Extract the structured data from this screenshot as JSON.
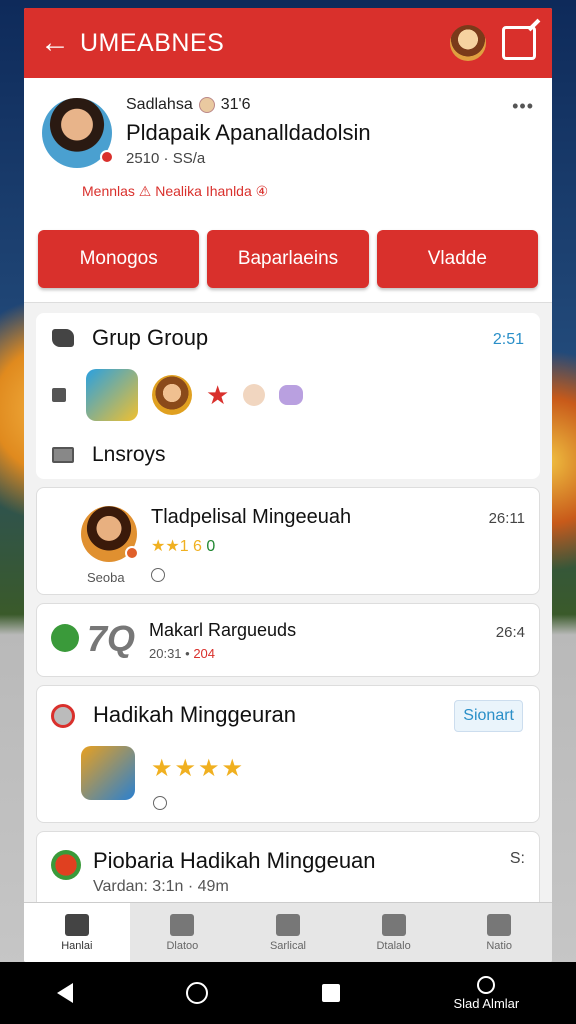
{
  "appbar": {
    "title": "UMEABNES"
  },
  "profile": {
    "handle": "Sadlahsa",
    "handle_meta": "31'6",
    "name": "Pldapaik Apanalldadolsin",
    "stats": "2510 · SS/a",
    "tagline": "Mennlas ⚠ Nealika Ihanlda ④"
  },
  "actions": {
    "btn1": "Monogos",
    "btn2": "Baparlaeins",
    "btn3": "Vladde"
  },
  "group": {
    "title": "Grup Group",
    "time": "2:51",
    "section_label": "Lnsroys"
  },
  "feed": [
    {
      "name": "Tladpelisal Mingeeuah",
      "rating_text": "★★1 6 ",
      "rating_tail": "0",
      "caption": "Seoba",
      "time": "26:11"
    },
    {
      "badge_text": "7Q",
      "name": "Makarl Rargueuds",
      "sub": "20:31 •",
      "sub_red": "204",
      "time": "26:4"
    },
    {
      "name": "Hadikah Minggeuran",
      "pill": "Sionart",
      "stars": "★★★★"
    },
    {
      "name": "Piobaria Hadikah Minggeuan",
      "sub": "Vardan: 3:1n · 49m",
      "time": "S:"
    }
  ],
  "bottom_nav": [
    "Hanlai",
    "Dlatoo",
    "Sarlical",
    "Dtalalo",
    "Natio"
  ],
  "system_bar": {
    "account_label": "Slad Almlar"
  },
  "colors": {
    "brand_red": "#d9302c",
    "accent_blue": "#2a8fc8",
    "star_gold": "#f0b020"
  }
}
